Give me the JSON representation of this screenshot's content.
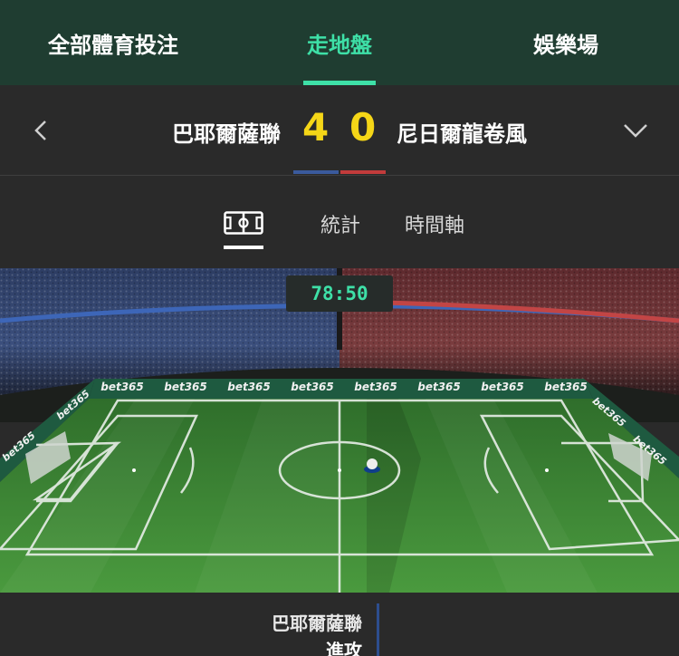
{
  "top_nav": {
    "tabs": [
      {
        "label": "全部體育投注",
        "active": false
      },
      {
        "label": "走地盤",
        "active": true
      },
      {
        "label": "娛樂場",
        "active": false
      }
    ]
  },
  "match": {
    "home_team": "巴耶爾薩聯",
    "away_team": "尼日爾龍卷風",
    "home_score": "4",
    "away_score": "0",
    "home_color": "#3a5a9c",
    "away_color": "#c23b3b"
  },
  "sub_tabs": {
    "pitch_icon": "pitch-icon",
    "stats": "統計",
    "timeline": "時間軸"
  },
  "live": {
    "clock": "78:50",
    "ad_text": "bet365"
  },
  "event": {
    "team": "巴耶爾薩聯",
    "action": "進攻"
  },
  "colors": {
    "accent": "#3ee0a7",
    "score": "#f5d617",
    "header_bg": "#1f3d31",
    "bg": "#2a2a2a",
    "pitch_green": "#3e8a35"
  }
}
